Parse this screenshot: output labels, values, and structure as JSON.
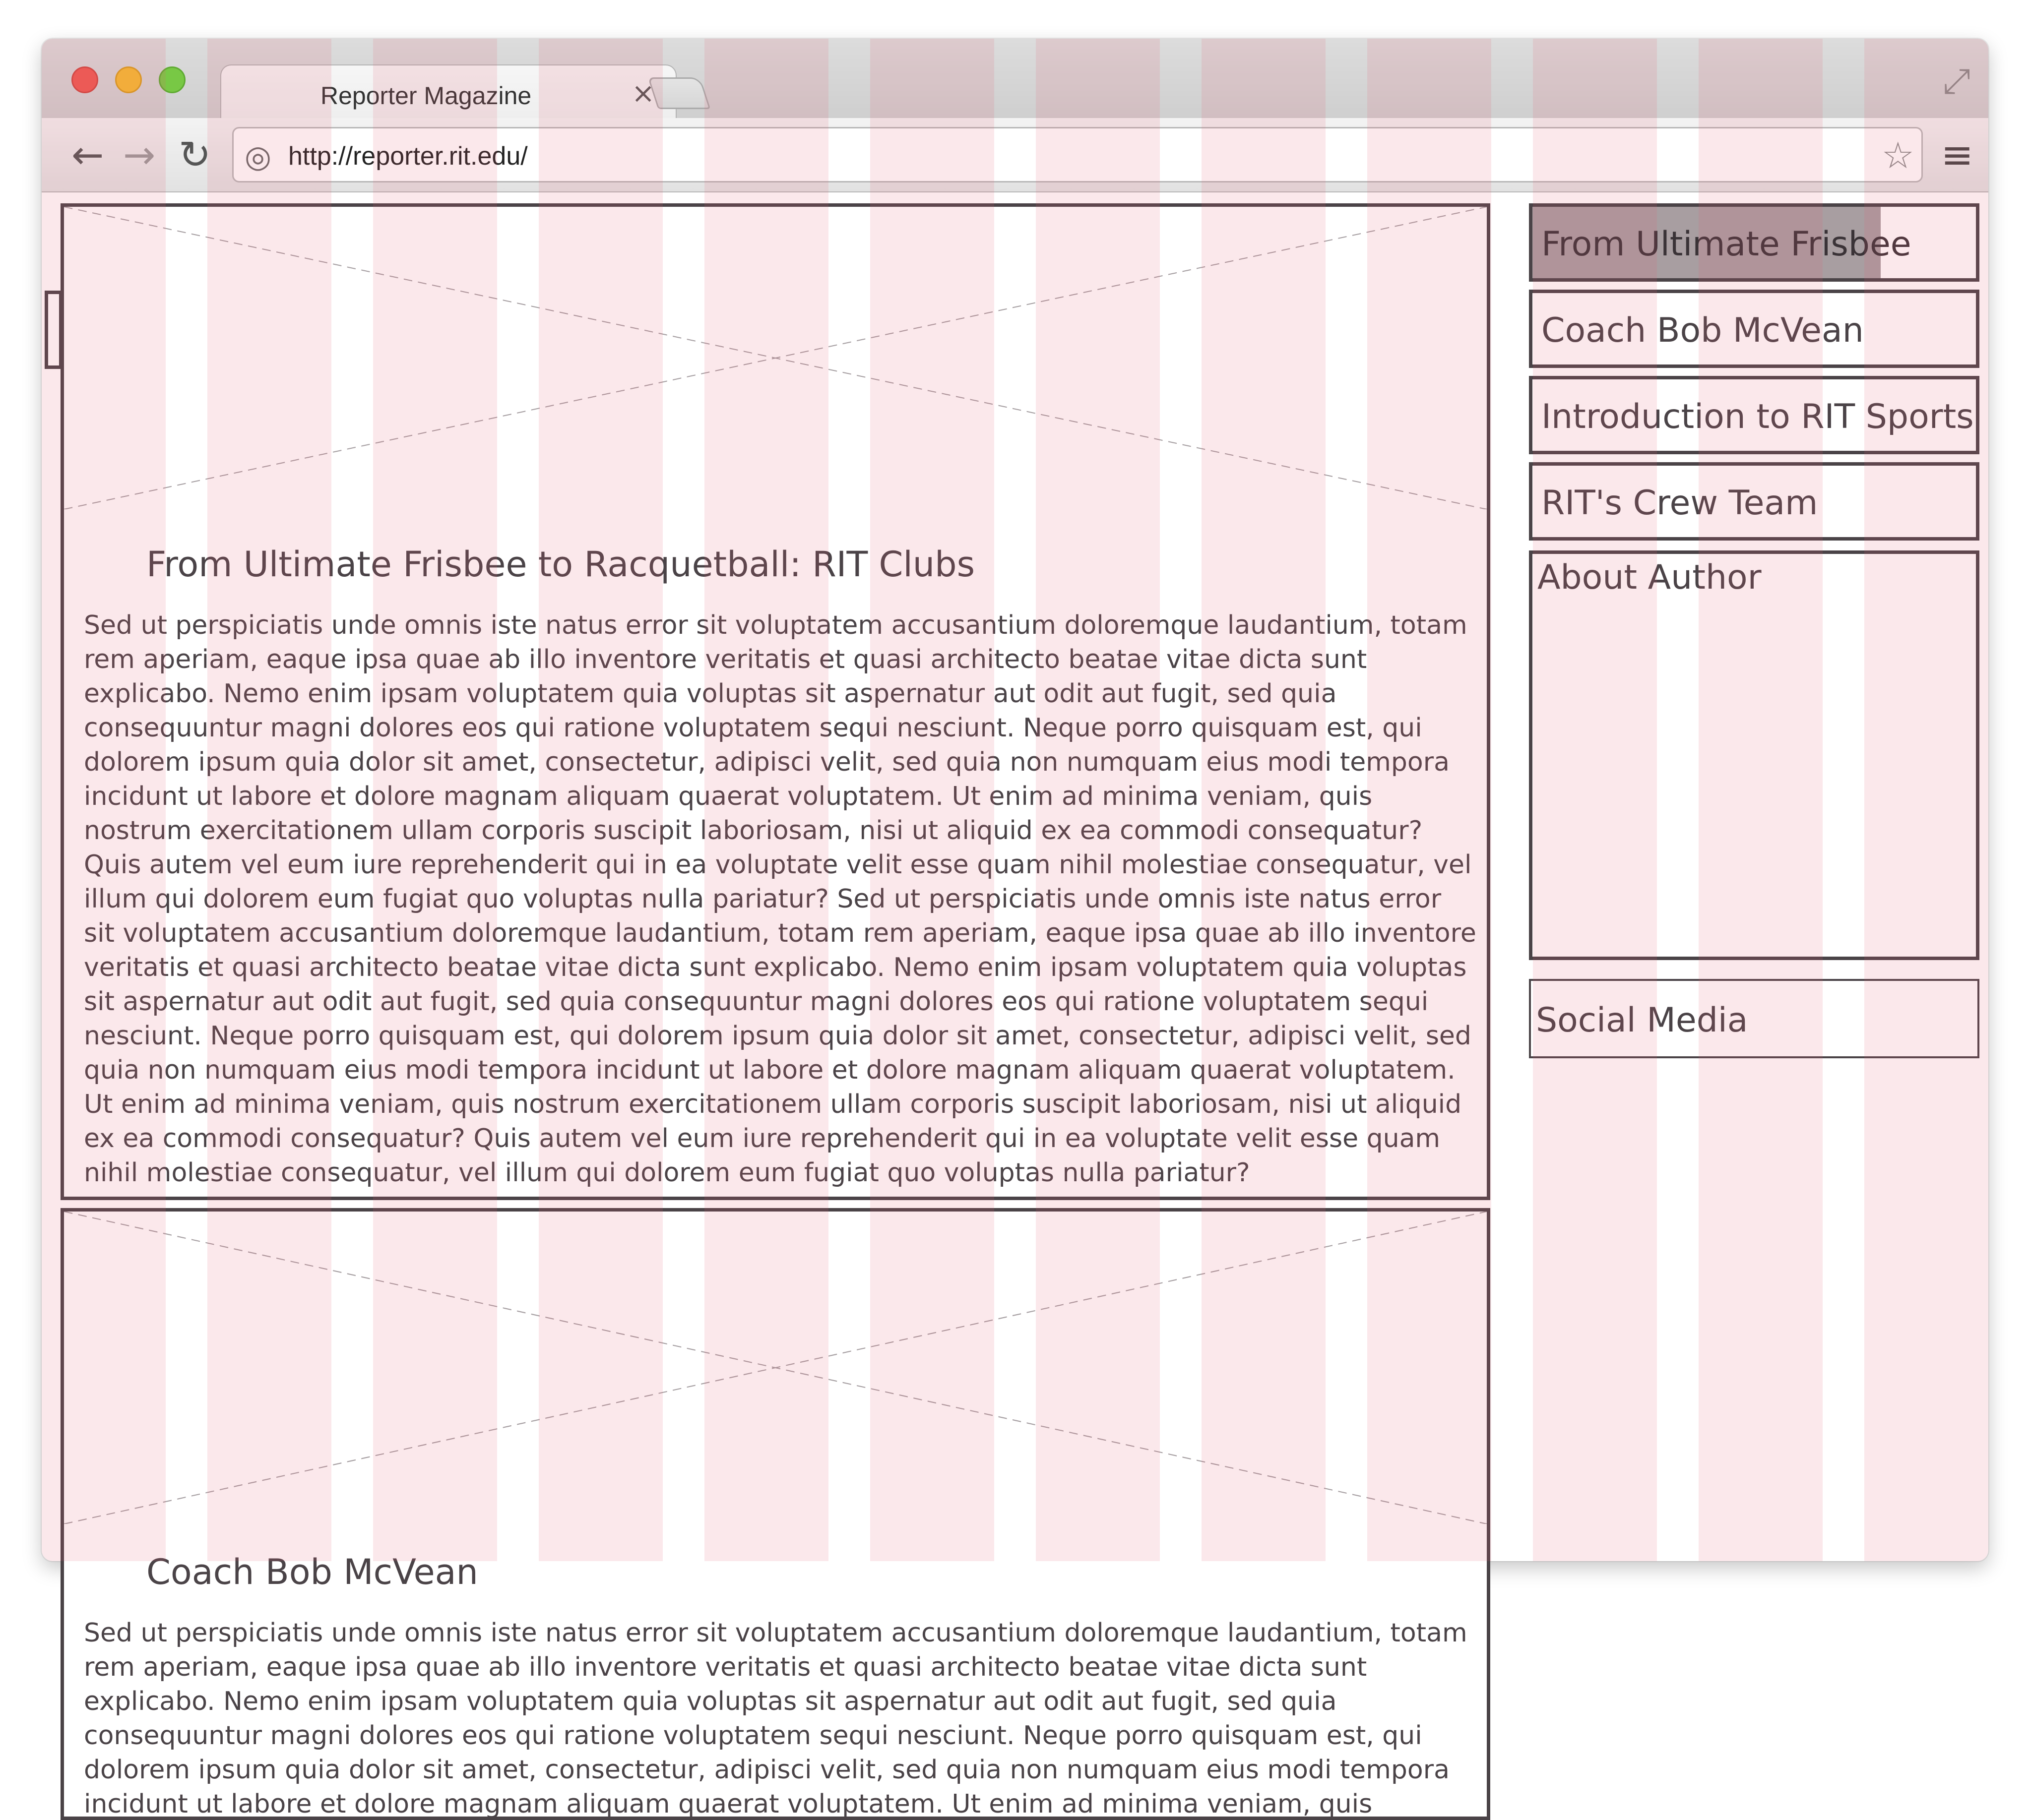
{
  "browser": {
    "tab_title": "Reporter Magazine",
    "tab_close_icon": "close-icon",
    "url": "http://reporter.rit.edu/"
  },
  "icons": {
    "back": "back-arrow-icon",
    "forward": "forward-arrow-icon",
    "reload": "reload-icon",
    "globe": "globe-icon",
    "bookmark": "star-icon",
    "menu": "hamburger-menu-icon",
    "fullscreen": "fullscreen-icon"
  },
  "colors": {
    "grid_overlay": "#e65f6e",
    "border": "#4a4347",
    "active_highlight": "#a89ea1"
  },
  "articles": [
    {
      "headline": "From Ultimate Frisbee to Racquetball: RIT Clubs",
      "body": "Sed ut perspiciatis unde omnis iste natus error sit voluptatem accusantium doloremque laudantium, totam rem aperiam, eaque ipsa quae ab illo inventore veritatis et quasi architecto beatae vitae dicta sunt explicabo. Nemo enim ipsam voluptatem quia voluptas sit aspernatur aut odit aut fugit, sed quia consequuntur magni dolores eos qui ratione voluptatem sequi nesciunt. Neque porro quisquam est, qui dolorem ipsum quia dolor sit amet, consectetur, adipisci velit, sed quia non numquam eius modi tempora incidunt ut labore et dolore magnam aliquam quaerat voluptatem. Ut enim ad minima veniam, quis nostrum exercitationem ullam corporis suscipit laboriosam, nisi ut aliquid ex ea commodi consequatur? Quis autem vel eum iure reprehenderit qui in ea voluptate velit esse quam nihil molestiae consequatur, vel illum qui dolorem eum fugiat quo voluptas nulla pariatur? Sed ut perspiciatis unde omnis iste natus error sit voluptatem accusantium doloremque laudantium, totam rem aperiam, eaque ipsa quae ab illo inventore veritatis et quasi architecto beatae vitae dicta sunt explicabo. Nemo enim ipsam voluptatem quia voluptas sit aspernatur aut odit aut fugit, sed quia consequuntur magni dolores eos qui ratione voluptatem sequi nesciunt. Neque porro quisquam est, qui dolorem ipsum quia dolor sit amet, consectetur, adipisci velit, sed quia non numquam eius modi tempora incidunt ut labore et dolore magnam aliquam quaerat voluptatem. Ut enim ad minima veniam, quis nostrum exercitationem ullam corporis suscipit laboriosam, nisi ut aliquid ex ea commodi consequatur? Quis autem vel eum iure reprehenderit qui in ea voluptate velit esse quam nihil molestiae consequatur, vel illum qui dolorem eum fugiat quo voluptas nulla pariatur?"
    },
    {
      "headline": "Coach Bob McVean",
      "body": "Sed ut perspiciatis unde omnis iste natus error sit voluptatem accusantium doloremque laudantium, totam rem aperiam, eaque ipsa quae ab illo inventore veritatis et quasi architecto beatae vitae dicta sunt explicabo. Nemo enim ipsam voluptatem quia voluptas sit aspernatur aut odit aut fugit, sed quia consequuntur magni dolores eos qui ratione voluptatem sequi nesciunt. Neque porro quisquam est, qui dolorem ipsum quia dolor sit amet, consectetur, adipisci velit, sed quia non numquam eius modi tempora incidunt ut labore et dolore magnam aliquam quaerat voluptatem. Ut enim ad minima veniam, quis nostrum exercitationem ullam corporis suscipit"
    }
  ],
  "sidebar": {
    "items": [
      {
        "label": "From Ultimate Frisbee",
        "active": true
      },
      {
        "label": "Coach Bob McVean",
        "active": false
      },
      {
        "label": "Introduction to RIT Sports",
        "active": false
      },
      {
        "label": "RIT's Crew Team",
        "active": false
      }
    ],
    "about_author": "About Author",
    "social_media": "Social Media"
  }
}
